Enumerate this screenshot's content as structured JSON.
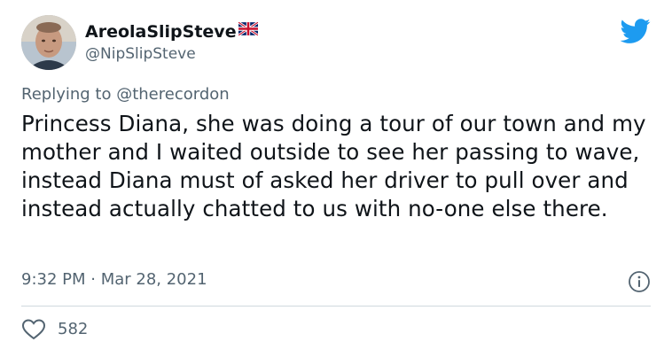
{
  "user": {
    "display_name": "AreolaSlipSteve",
    "flag_icon": "uk-flag-icon",
    "handle": "@NipSlipSteve",
    "avatar_icon": "avatar-photo"
  },
  "reply": {
    "prefix": "Replying to ",
    "mention": "@therecordon"
  },
  "tweet": {
    "text": "Princess Diana, she was doing a tour of our town and my mother and I waited outside to see her passing to wave, instead Diana must of asked her driver to pull over and instead actually chatted to us with no-one else there.",
    "timestamp": "9:32 PM · Mar 28, 2021"
  },
  "actions": {
    "like_count": "582",
    "like_icon": "heart-icon",
    "info_icon": "info-icon"
  },
  "brand": {
    "icon": "twitter-bird-icon",
    "color": "#1d9bf0"
  }
}
